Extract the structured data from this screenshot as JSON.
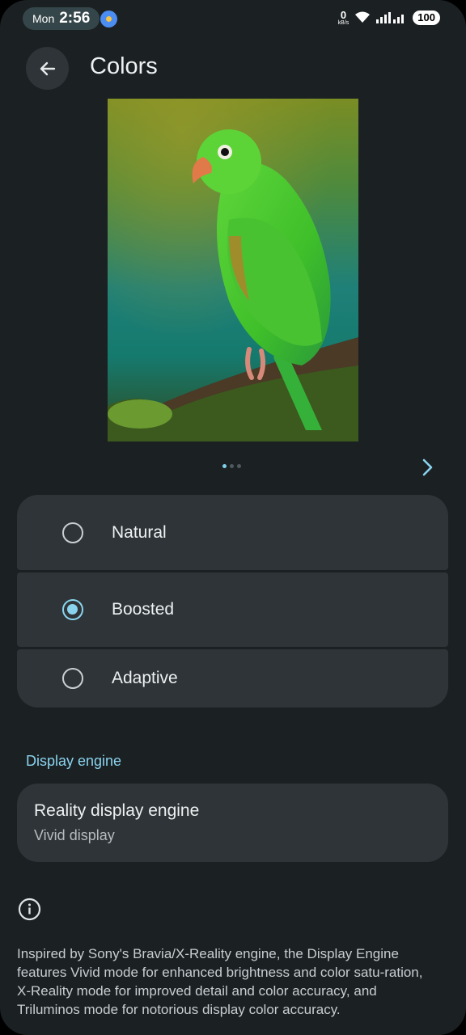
{
  "status_bar": {
    "day": "Mon",
    "time": "2:56",
    "net_speed_value": "0",
    "net_speed_unit": "kB/s",
    "battery": "100"
  },
  "header": {
    "title": "Colors",
    "back_icon": "arrow-left-icon"
  },
  "preview": {
    "page_count": 3,
    "active_page": 1,
    "next_icon": "chevron-right-icon"
  },
  "color_modes": {
    "options": [
      {
        "label": "Natural",
        "selected": false
      },
      {
        "label": "Boosted",
        "selected": true
      },
      {
        "label": "Adaptive",
        "selected": false
      }
    ]
  },
  "display_engine": {
    "section_label": "Display engine",
    "title": "Reality display engine",
    "subtitle": "Vivid display"
  },
  "footer": {
    "icon": "info-icon",
    "text": "Inspired by Sony's Bravia/X-Reality engine, the Display Engine features Vivid mode for enhanced brightness and color satu-ration, X-Reality mode for improved detail and color accuracy, and Triluminos mode for notorious display color accuracy."
  },
  "colors": {
    "background": "#1b2023",
    "card": "#2e3437",
    "accent": "#8ad3ee"
  }
}
